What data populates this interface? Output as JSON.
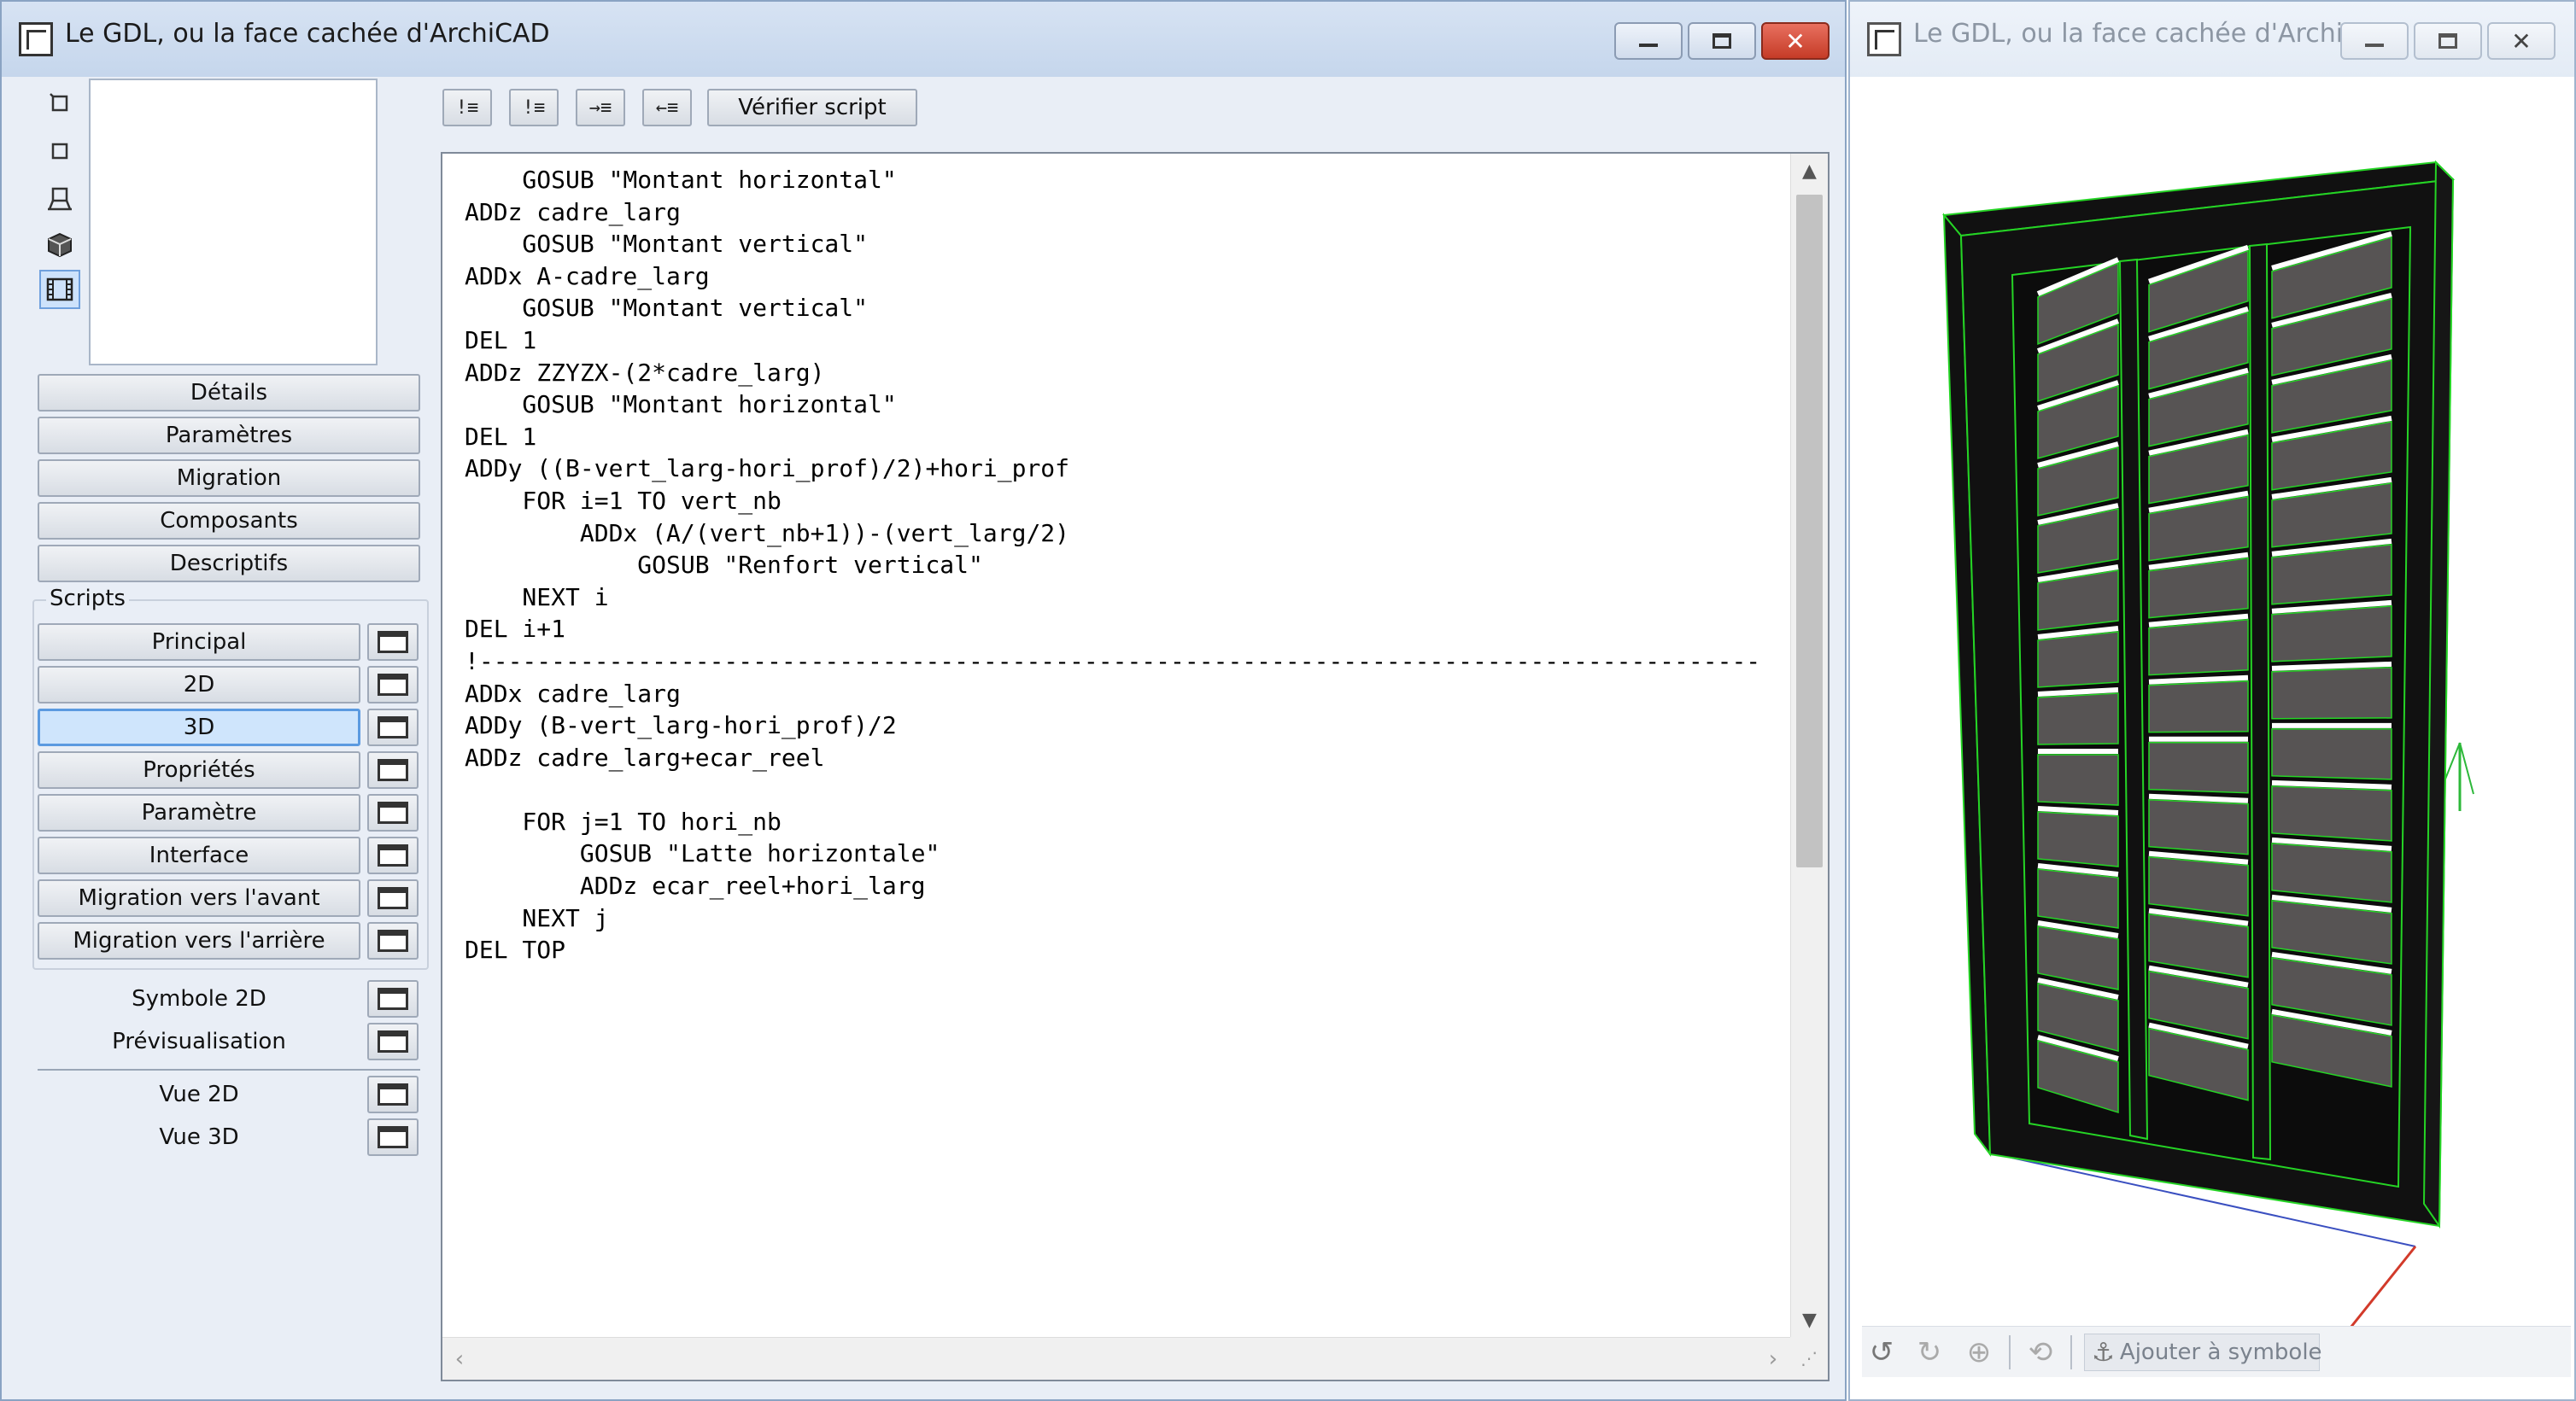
{
  "left_window": {
    "title": "Le GDL, ou la face cachée d'ArchiCAD"
  },
  "right_window": {
    "title": "Le GDL, ou la face cachée d'ArchiC..."
  },
  "sidebar": {
    "tool_icons": [
      "rotate-icon",
      "square-icon",
      "stand-icon",
      "cube-icon",
      "film-icon"
    ],
    "buttons": [
      "Détails",
      "Paramètres",
      "Migration",
      "Composants",
      "Descriptifs"
    ],
    "scripts_label": "Scripts",
    "scripts": [
      "Principal",
      "2D",
      "3D",
      "Propriétés",
      "Paramètre",
      "Interface",
      "Migration vers l'avant",
      "Migration vers l'arrière"
    ],
    "active_script": "3D",
    "views": [
      "Symbole 2D",
      "Prévisualisation"
    ],
    "views2": [
      "Vue 2D",
      "Vue 3D"
    ]
  },
  "toolbar": {
    "icons": [
      "comment-icon",
      "uncomment-icon",
      "indent-icon",
      "outdent-icon"
    ],
    "icon_glyphs": [
      "!≡",
      "!≡",
      "→≡",
      "←≡"
    ],
    "verify_label": "Vérifier script"
  },
  "editor": {
    "lines": [
      "    GOSUB \"Montant horizontal\"",
      "ADDz cadre_larg",
      "    GOSUB \"Montant vertical\"",
      "ADDx A-cadre_larg",
      "    GOSUB \"Montant vertical\"",
      "DEL 1",
      "ADDz ZZYZX-(2*cadre_larg)",
      "    GOSUB \"Montant horizontal\"",
      "DEL 1",
      "ADDy ((B-vert_larg-hori_prof)/2)+hori_prof",
      "    FOR i=1 TO vert_nb",
      "        ADDx (A/(vert_nb+1))-(vert_larg/2)",
      "            GOSUB \"Renfort vertical\"",
      "    NEXT i",
      "DEL i+1",
      "!-----------------------------------------------------------------------------------------",
      "ADDx cadre_larg",
      "ADDy (B-vert_larg-hori_prof)/2",
      "ADDz cadre_larg+ecar_reel",
      "",
      "    FOR j=1 TO hori_nb",
      "        GOSUB \"Latte horizontale\"",
      "        ADDz ecar_reel+hori_larg",
      "    NEXT j",
      "DEL TOP"
    ]
  },
  "view3d_toolbar": {
    "add_symbol_label": "Ajouter à symbole",
    "icons": [
      "undo-rotate-icon",
      "redo-rotate-icon",
      "zoom-icon",
      "pan-icon",
      "symbol-icon"
    ]
  },
  "colors": {
    "frame": "#111111",
    "slat": "#575454",
    "edge": "#25d425",
    "gap": "#ffffff",
    "axis_x": "#3a4fc0",
    "axis_y": "#d23a2a",
    "axis_z": "#2db83a"
  }
}
